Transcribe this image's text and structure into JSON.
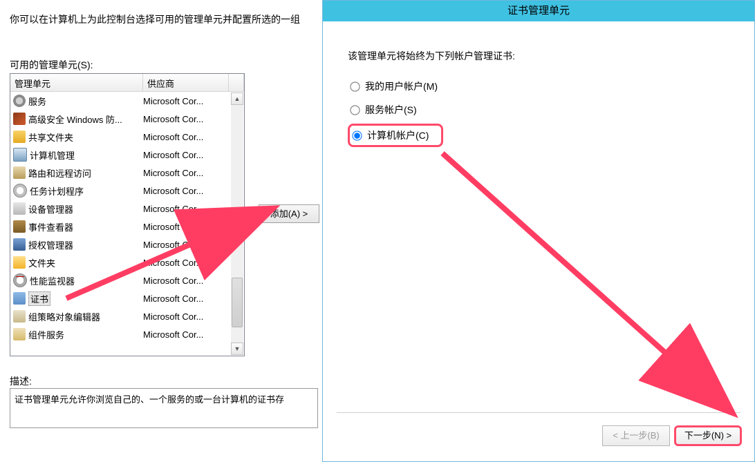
{
  "instruction_text": "你可以在计算机上为此控制台选择可用的管理单元并配置所选的一组",
  "available_label": "可用的管理单元(S):",
  "columns": {
    "name": "管理单元",
    "vendor": "供应商"
  },
  "rows": [
    {
      "icon": "ic-gear",
      "name": "服务",
      "vendor": "Microsoft Cor..."
    },
    {
      "icon": "ic-shield",
      "name": "高级安全 Windows 防...",
      "vendor": "Microsoft Cor..."
    },
    {
      "icon": "ic-folder-share",
      "name": "共享文件夹",
      "vendor": "Microsoft Cor..."
    },
    {
      "icon": "ic-computer",
      "name": "计算机管理",
      "vendor": "Microsoft Cor..."
    },
    {
      "icon": "ic-route",
      "name": "路由和远程访问",
      "vendor": "Microsoft Cor..."
    },
    {
      "icon": "ic-clock",
      "name": "任务计划程序",
      "vendor": "Microsoft Cor..."
    },
    {
      "icon": "ic-device",
      "name": "设备管理器",
      "vendor": "Microsoft Cor..."
    },
    {
      "icon": "ic-event",
      "name": "事件查看器",
      "vendor": "Microsoft Cor..."
    },
    {
      "icon": "ic-auth",
      "name": "授权管理器",
      "vendor": "Microsoft Cor..."
    },
    {
      "icon": "ic-folder",
      "name": "文件夹",
      "vendor": "Microsoft Cor..."
    },
    {
      "icon": "ic-perf",
      "name": "性能监视器",
      "vendor": "Microsoft Cor..."
    },
    {
      "icon": "ic-cert",
      "name": "证书",
      "vendor": "Microsoft Cor...",
      "selected": true
    },
    {
      "icon": "ic-gpo",
      "name": "组策略对象编辑器",
      "vendor": "Microsoft Cor..."
    },
    {
      "icon": "ic-comp",
      "name": "组件服务",
      "vendor": "Microsoft Cor..."
    }
  ],
  "add_button": "添加(A) >",
  "description_label": "描述:",
  "description_text": "证书管理单元允许你浏览自己的、一个服务的或一台计算机的证书存",
  "wizard": {
    "title": "证书管理单元",
    "prompt": "该管理单元将始终为下列帐户管理证书:",
    "options": {
      "user": "我的用户帐户(M)",
      "service": "服务帐户(S)",
      "computer": "计算机帐户(C)"
    },
    "back": "< 上一步(B)",
    "next": "下一步(N) >"
  }
}
